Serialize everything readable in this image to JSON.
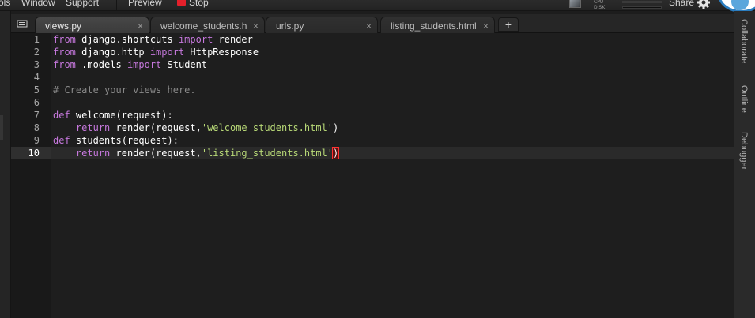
{
  "menu": {
    "items": [
      "ols",
      "Window",
      "Support",
      "Preview",
      "Stop"
    ],
    "cpu_label": "CPU",
    "disk_label": "DISK",
    "share_label": "Share"
  },
  "tabs": [
    {
      "label": "views.py",
      "active": true
    },
    {
      "label": "welcome_students.h",
      "active": false
    },
    {
      "label": "urls.py",
      "active": false
    },
    {
      "label": "listing_students.html",
      "active": false
    }
  ],
  "new_tab_label": "+",
  "close_glyph": "×",
  "editor": {
    "current_line": 10,
    "lines": [
      {
        "n": "1",
        "tokens": [
          [
            "kw",
            "from"
          ],
          [
            "id",
            " django.shortcuts "
          ],
          [
            "kw",
            "import"
          ],
          [
            "id",
            " render"
          ]
        ]
      },
      {
        "n": "2",
        "tokens": [
          [
            "kw",
            "from"
          ],
          [
            "id",
            " django.http "
          ],
          [
            "kw",
            "import"
          ],
          [
            "id",
            " HttpResponse"
          ]
        ]
      },
      {
        "n": "3",
        "tokens": [
          [
            "kw",
            "from"
          ],
          [
            "id",
            " .models "
          ],
          [
            "kw",
            "import"
          ],
          [
            "id",
            " Student"
          ]
        ]
      },
      {
        "n": "4",
        "tokens": []
      },
      {
        "n": "5",
        "tokens": [
          [
            "cm",
            "# Create your views here."
          ]
        ]
      },
      {
        "n": "6",
        "tokens": []
      },
      {
        "n": "7",
        "tokens": [
          [
            "kw",
            "def"
          ],
          [
            "id",
            " welcome(request):"
          ]
        ]
      },
      {
        "n": "8",
        "tokens": [
          [
            "id",
            "    "
          ],
          [
            "kw",
            "return"
          ],
          [
            "id",
            " render(request,"
          ],
          [
            "st",
            "'welcome_students.html'"
          ],
          [
            "id",
            ")"
          ]
        ]
      },
      {
        "n": "9",
        "tokens": [
          [
            "kw",
            "def"
          ],
          [
            "id",
            " students(request):"
          ]
        ]
      },
      {
        "n": "10",
        "tokens": [
          [
            "id",
            "    "
          ],
          [
            "kw",
            "return"
          ],
          [
            "id",
            " render(request,"
          ],
          [
            "st",
            "'listing_students.html'"
          ],
          [
            "bm",
            ")"
          ]
        ]
      }
    ]
  },
  "side_panels": [
    "Collaborate",
    "Outline",
    "Debugger"
  ],
  "colors": {
    "keyword": "#c678dd",
    "string": "#b8d977",
    "comment": "#8a8a8a",
    "stop": "#e4202b"
  }
}
